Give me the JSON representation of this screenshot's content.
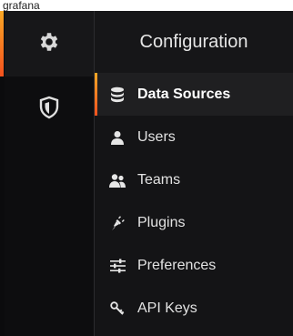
{
  "caption": "grafana",
  "sidebar": {
    "items": [
      {
        "icon": "gear-icon",
        "active": true
      },
      {
        "icon": "shield-icon",
        "active": false
      }
    ]
  },
  "panel": {
    "title": "Configuration",
    "items": [
      {
        "label": "Data Sources",
        "icon": "database-icon",
        "active": true
      },
      {
        "label": "Users",
        "icon": "user-icon"
      },
      {
        "label": "Teams",
        "icon": "users-icon"
      },
      {
        "label": "Plugins",
        "icon": "plug-icon"
      },
      {
        "label": "Preferences",
        "icon": "sliders-icon"
      },
      {
        "label": "API Keys",
        "icon": "key-icon"
      }
    ]
  },
  "colors": {
    "accent_top": "#f9a825",
    "accent_bottom": "#f4511e",
    "background": "#141416",
    "text": "#e2e2e2"
  }
}
